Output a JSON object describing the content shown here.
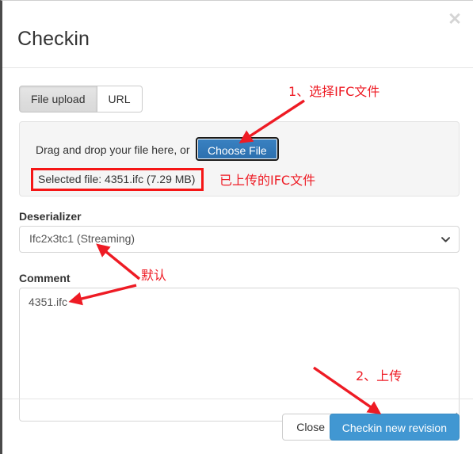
{
  "dialog": {
    "title": "Checkin",
    "close_icon": "close-x-icon"
  },
  "tabs": [
    {
      "label": "File upload",
      "active": true
    },
    {
      "label": "URL",
      "active": false
    }
  ],
  "dropzone": {
    "prompt": "Drag and drop your file here, or",
    "choose_file_label": "Choose File",
    "selected_file": "Selected file: 4351.ifc (7.29 MB)",
    "highlight_color": "#f51616"
  },
  "deserializer": {
    "label": "Deserializer",
    "value": "Ifc2x3tc1 (Streaming)",
    "chevron_icon": "chevron-down-icon"
  },
  "comment": {
    "label": "Comment",
    "value": "4351.ifc",
    "placeholder": ""
  },
  "footer": {
    "close_label": "Close",
    "submit_label": "Checkin new revision",
    "submit_color": "#4197d2"
  },
  "annotations": {
    "step1": "1、选择IFC文件",
    "uploaded_file_note": "已上传的IFC文件",
    "default_note": "默认",
    "step2": "2、上传",
    "color": "#ee1b24"
  }
}
